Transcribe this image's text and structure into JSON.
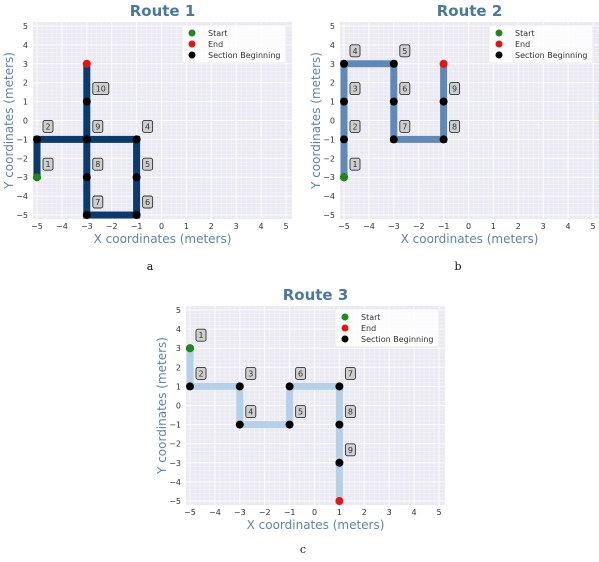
{
  "chart_data": [
    {
      "type": "line",
      "title": "Route 1",
      "caption": "a",
      "xlabel": "X coordinates (meters)",
      "ylabel": "Y coordinates (meters)",
      "xlim": [
        -5,
        5
      ],
      "ylim": [
        -5,
        5
      ],
      "xticks": [
        "−5",
        "−4",
        "−3",
        "−2",
        "−1",
        "0",
        "1",
        "2",
        "3",
        "4",
        "5"
      ],
      "yticks": [
        "−5",
        "−4",
        "−3",
        "−2",
        "−1",
        "0",
        "1",
        "2",
        "3",
        "4",
        "5"
      ],
      "grid": true,
      "legend_position": "top-right",
      "line_color": "#0b3a6e",
      "points": [
        [
          -5,
          -3
        ],
        [
          -5,
          -1
        ],
        [
          -3,
          -1
        ],
        [
          -1,
          -1
        ],
        [
          -1,
          -3
        ],
        [
          -1,
          -5
        ],
        [
          -3,
          -5
        ],
        [
          -3,
          -3
        ],
        [
          -3,
          -1
        ],
        [
          -3,
          1
        ],
        [
          -3,
          3
        ]
      ],
      "path": [
        [
          -5,
          -3
        ],
        [
          -5,
          -1
        ],
        [
          -1,
          -1
        ],
        [
          -1,
          -5
        ],
        [
          -3,
          -5
        ],
        [
          -3,
          3
        ]
      ],
      "section_beginnings": [
        {
          "label": "1",
          "x": -5,
          "y": -3
        },
        {
          "label": "2",
          "x": -5,
          "y": -1
        },
        {
          "label": "4",
          "x": -1,
          "y": -1
        },
        {
          "label": "5",
          "x": -1,
          "y": -3
        },
        {
          "label": "6",
          "x": -1,
          "y": -5
        },
        {
          "label": "7",
          "x": -3,
          "y": -5
        },
        {
          "label": "8",
          "x": -3,
          "y": -3
        },
        {
          "label": "9",
          "x": -3,
          "y": -1
        },
        {
          "label": "10",
          "x": -3,
          "y": 1
        }
      ],
      "start": {
        "x": -5,
        "y": -3
      },
      "end": {
        "x": -3,
        "y": 3
      }
    },
    {
      "type": "line",
      "title": "Route 2",
      "caption": "b",
      "xlabel": "X coordinates (meters)",
      "ylabel": "Y coordinates (meters)",
      "xlim": [
        -5,
        5
      ],
      "ylim": [
        -5,
        5
      ],
      "xticks": [
        "−5",
        "−4",
        "−3",
        "−2",
        "−1",
        "0",
        "1",
        "2",
        "3",
        "4",
        "5"
      ],
      "yticks": [
        "−5",
        "−4",
        "−3",
        "−2",
        "−1",
        "0",
        "1",
        "2",
        "3",
        "4",
        "5"
      ],
      "grid": true,
      "legend_position": "top-right",
      "line_color": "#5f89b8",
      "path": [
        [
          -5,
          -3
        ],
        [
          -5,
          3
        ],
        [
          -3,
          3
        ],
        [
          -3,
          -1
        ],
        [
          -1,
          -1
        ],
        [
          -1,
          3
        ]
      ],
      "section_beginnings": [
        {
          "label": "1",
          "x": -5,
          "y": -3
        },
        {
          "label": "2",
          "x": -5,
          "y": -1
        },
        {
          "label": "3",
          "x": -5,
          "y": 1
        },
        {
          "label": "4",
          "x": -5,
          "y": 3
        },
        {
          "label": "5",
          "x": -3,
          "y": 3
        },
        {
          "label": "6",
          "x": -3,
          "y": 1
        },
        {
          "label": "7",
          "x": -3,
          "y": -1
        },
        {
          "label": "8",
          "x": -1,
          "y": -1
        },
        {
          "label": "9",
          "x": -1,
          "y": 1
        }
      ],
      "start": {
        "x": -5,
        "y": -3
      },
      "end": {
        "x": -1,
        "y": 3
      }
    },
    {
      "type": "line",
      "title": "Route 3",
      "caption": "c",
      "xlabel": "X coordinates (meters)",
      "ylabel": "Y coordinates (meters)",
      "xlim": [
        -5,
        5
      ],
      "ylim": [
        -5,
        5
      ],
      "xticks": [
        "−5",
        "−4",
        "−3",
        "−2",
        "−1",
        "0",
        "1",
        "2",
        "3",
        "4",
        "5"
      ],
      "yticks": [
        "−5",
        "−4",
        "−3",
        "−2",
        "−1",
        "0",
        "1",
        "2",
        "3",
        "4",
        "5"
      ],
      "grid": true,
      "legend_position": "top-right",
      "line_color": "#b5d1ea",
      "path": [
        [
          -5,
          3
        ],
        [
          -5,
          1
        ],
        [
          -3,
          1
        ],
        [
          -3,
          -1
        ],
        [
          -1,
          -1
        ],
        [
          -1,
          1
        ],
        [
          1,
          1
        ],
        [
          1,
          -5
        ]
      ],
      "section_beginnings": [
        {
          "label": "1",
          "x": -5,
          "y": 3
        },
        {
          "label": "2",
          "x": -5,
          "y": 1
        },
        {
          "label": "3",
          "x": -3,
          "y": 1
        },
        {
          "label": "4",
          "x": -3,
          "y": -1
        },
        {
          "label": "5",
          "x": -1,
          "y": -1
        },
        {
          "label": "6",
          "x": -1,
          "y": 1
        },
        {
          "label": "7",
          "x": 1,
          "y": 1
        },
        {
          "label": "8",
          "x": 1,
          "y": -1
        },
        {
          "label": "9",
          "x": 1,
          "y": -3
        }
      ],
      "start": {
        "x": -5,
        "y": 3
      },
      "end": {
        "x": 1,
        "y": -5
      }
    }
  ],
  "legend": {
    "start_label": "Start",
    "end_label": "End",
    "section_label": "Section Beginning",
    "start_color": "#1a8a1a",
    "end_color": "#ee1111",
    "section_color": "#000000"
  }
}
